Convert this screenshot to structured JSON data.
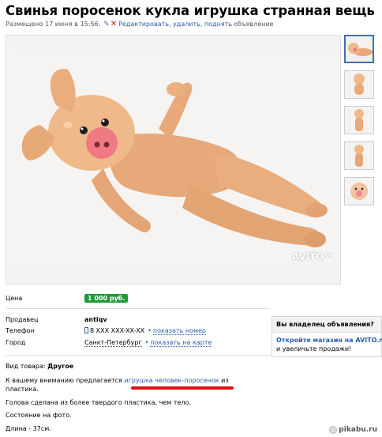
{
  "listing": {
    "title": "Свинья поросенок кукла игрушка странная вещь",
    "meta_prefix": "Размещено 17 июня в 15:56.",
    "edit_link": "Редактировать",
    "delete_link": "удалить",
    "raise_link": "поднять",
    "meta_suffix": "объявление",
    "watermark": "AVITO",
    "watermark_suffix": ".ru"
  },
  "details": {
    "price_label": "Цена",
    "price_value": "1 000 руб.",
    "seller_label": "Продавец",
    "seller_value": "antiqv",
    "phone_label": "Телефон",
    "phone_value": "8 XXX XXX-XX-XX",
    "show_phone": "показать номер",
    "city_label": "Город",
    "city_value": "Санкт-Петербург",
    "show_map": "показать на карте"
  },
  "owner_box": {
    "heading": "Вы владелец объявления?",
    "link_prefix": "Откройте магазин на",
    "link_text": "AVITO.ru",
    "line2": "и увеличьте продажи!"
  },
  "description": {
    "type_label": "Вид товара:",
    "type_value": "Другое",
    "line1_a": "К вашему вниманию предлагается",
    "line1_highlight": "игрушка человек-поросенок",
    "line1_b": "из",
    "line1_c": "пластика.",
    "line2": "Голова сделана из более твердого пластика, чем тело.",
    "line3": "Состояние на фото.",
    "line4": "Длина - 37см."
  },
  "site_mark": "pikabu.ru",
  "colors": {
    "price_badge": "#1e9a3a",
    "link": "#2a5db0",
    "annotation": "#dd1111",
    "thumb_active_border": "#3b6fb6"
  }
}
